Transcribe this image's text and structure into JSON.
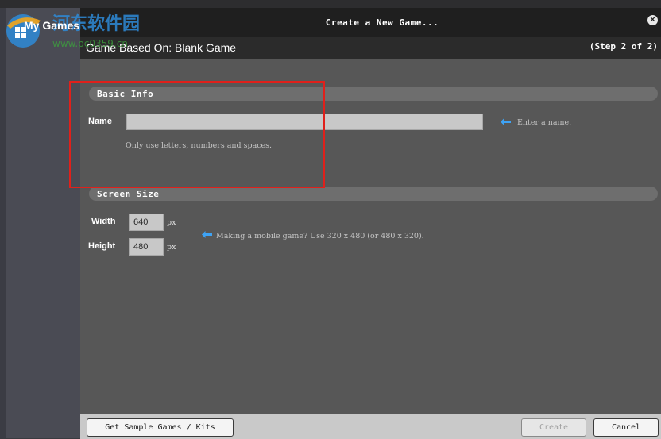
{
  "app": {
    "sidebar_title": "My Games"
  },
  "dialog": {
    "title": "Create a New Game...",
    "subheader_title": "Game Based On: Blank Game",
    "step_indicator": "(Step 2 of 2)"
  },
  "basic_info": {
    "section_title": "Basic Info",
    "name_label": "Name",
    "name_value": "",
    "name_hint": "Enter a name.",
    "name_note": "Only use letters, numbers and spaces."
  },
  "screen_size": {
    "section_title": "Screen Size",
    "width_label": "Width",
    "width_value": "640",
    "width_unit": "px",
    "height_label": "Height",
    "height_value": "480",
    "height_unit": "px",
    "hint": "Making a mobile game? Use 320 x 480 (or 480 x 320)."
  },
  "footer": {
    "sample_button": "Get Sample Games / Kits",
    "create_button": "Create",
    "cancel_button": "Cancel"
  },
  "watermark": {
    "text_cn": "河东软件园",
    "text_url": "www.pc0359.cn"
  },
  "colors": {
    "accent_arrow": "#3ea3f5",
    "highlight": "#e0201b"
  }
}
